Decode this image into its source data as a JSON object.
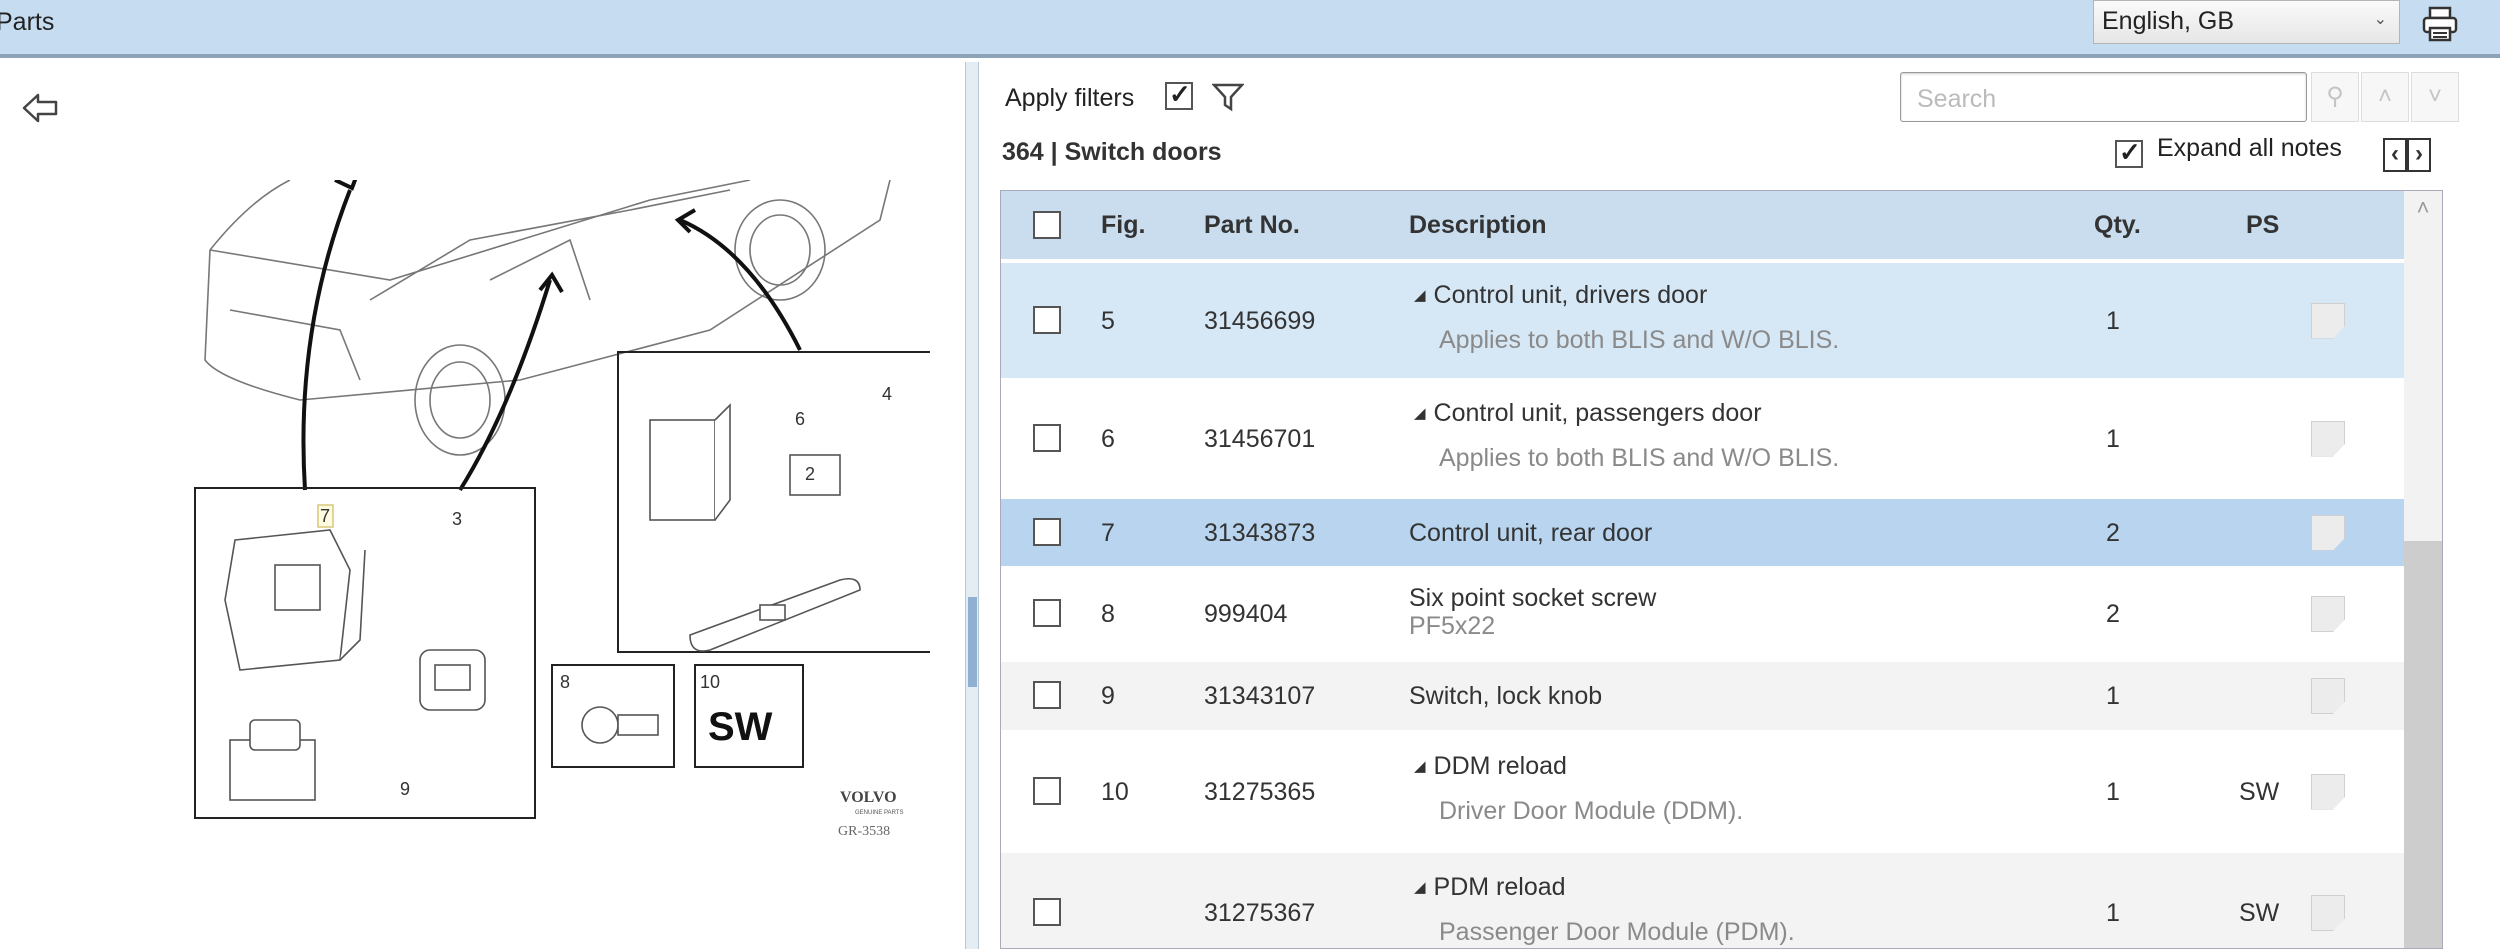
{
  "header": {
    "title": "Parts",
    "language": "English, GB",
    "print_icon": "printer-icon"
  },
  "diagram": {
    "labels": [
      "7",
      "3",
      "9",
      "6",
      "4",
      "2",
      "8",
      "10"
    ],
    "sw_label": "SW",
    "brand": "VOLVO",
    "brand_sub": "GENUINE PARTS",
    "ref": "GR-3538"
  },
  "toolbar": {
    "apply_filters": "Apply filters",
    "apply_filters_checked": true,
    "search_placeholder": "Search",
    "group_no": "364",
    "group_sep": "|",
    "group_name": "Switch doors",
    "expand_all_notes": "Expand all notes",
    "expand_checked": true,
    "prev": "‹",
    "next": "›"
  },
  "table": {
    "columns": {
      "fig": "Fig.",
      "part_no": "Part No.",
      "description": "Description",
      "qty": "Qty.",
      "ps": "PS"
    },
    "rows": [
      {
        "fig": "5",
        "part_no": "31456699",
        "description": "Control unit, drivers door",
        "note": "Applies to both BLIS and W/O BLIS.",
        "qty": "1",
        "ps": "",
        "expandable": true
      },
      {
        "fig": "6",
        "part_no": "31456701",
        "description": "Control unit, passengers door",
        "note": "Applies to both BLIS and W/O BLIS.",
        "qty": "1",
        "ps": "",
        "expandable": true
      },
      {
        "fig": "7",
        "part_no": "31343873",
        "description": "Control unit, rear door",
        "note": "",
        "qty": "2",
        "ps": "",
        "expandable": false
      },
      {
        "fig": "8",
        "part_no": "999404",
        "description": "Six point socket screw",
        "note": "PF5x22",
        "qty": "2",
        "ps": "",
        "expandable": false
      },
      {
        "fig": "9",
        "part_no": "31343107",
        "description": "Switch, lock knob",
        "note": "",
        "qty": "1",
        "ps": "",
        "expandable": false
      },
      {
        "fig": "10",
        "part_no": "31275365",
        "description": "DDM reload",
        "note": "Driver Door Module (DDM).",
        "qty": "1",
        "ps": "SW",
        "expandable": true
      },
      {
        "fig": "",
        "part_no": "31275367",
        "description": "PDM reload",
        "note": "Passenger Door Module (PDM).",
        "qty": "1",
        "ps": "SW",
        "expandable": true
      }
    ]
  },
  "colors": {
    "topbar": "#c6dcf1",
    "header": "#c9ddef",
    "row_hover": "#d6e7f5",
    "row_selected": "#b8d4ee"
  }
}
